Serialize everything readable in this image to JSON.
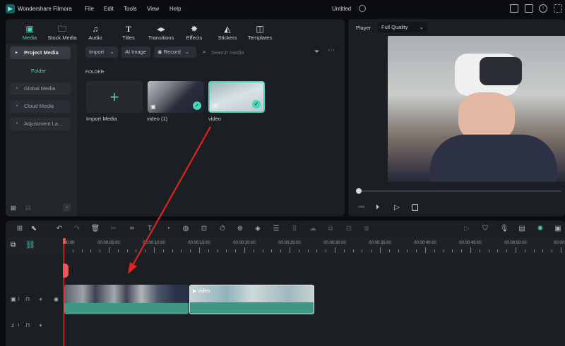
{
  "app": {
    "name": "Wondershare Filmora",
    "menu": [
      "File",
      "Edit",
      "Tools",
      "View",
      "Help"
    ],
    "project_title": "Untitled"
  },
  "tabs": [
    {
      "label": "Media",
      "icon": "media-icon"
    },
    {
      "label": "Stock Media",
      "icon": "stock-media-icon"
    },
    {
      "label": "Audio",
      "icon": "music-note-icon"
    },
    {
      "label": "Titles",
      "icon": "titles-icon"
    },
    {
      "label": "Transitions",
      "icon": "transitions-icon"
    },
    {
      "label": "Effects",
      "icon": "effects-icon"
    },
    {
      "label": "Stickers",
      "icon": "stickers-icon"
    },
    {
      "label": "Templates",
      "icon": "templates-icon"
    }
  ],
  "sidebar": {
    "project_media": "Project Media",
    "folder": "Folder",
    "items": [
      "Global Media",
      "Cloud Media",
      "Adjustment La..."
    ]
  },
  "media_toolbar": {
    "import": "Import",
    "ai_image": "AI Image",
    "record": "Record",
    "search_placeholder": "Search media"
  },
  "media": {
    "section": "FOLDER",
    "items": [
      {
        "label": "Import Media"
      },
      {
        "label": "video (1)",
        "checked": true
      },
      {
        "label": "video",
        "checked": true,
        "selected": true
      }
    ]
  },
  "player": {
    "label": "Player",
    "quality": "Full Quality",
    "progress": 0
  },
  "timeline": {
    "ruler_labels": [
      "00:00",
      "00:00:05:00",
      "00:00:10:00",
      "00:00:15:00",
      "00:00:20:00",
      "00:00:25:00",
      "00:00:30:00",
      "00:00:35:00",
      "00:00:40:00",
      "00:00:45:00",
      "00:00:50:00",
      "00:00:5"
    ],
    "video_track": "1",
    "audio_track": "1",
    "clip2_label": "video"
  },
  "colors": {
    "accent": "#4fd1b7",
    "clip": "#3e9782",
    "annotation_arrow": "#e0231f",
    "playhead": "#e8585a"
  }
}
